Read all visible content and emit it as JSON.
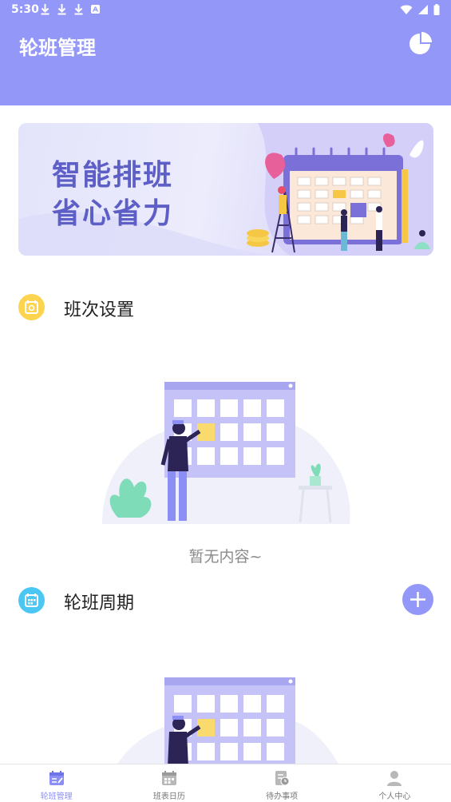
{
  "status": {
    "time": "5:30"
  },
  "header": {
    "title": "轮班管理"
  },
  "banner": {
    "line1": "智能排班",
    "line2": "省心省力"
  },
  "sections": [
    {
      "title": "班次设置",
      "empty_text": "暂无内容~"
    },
    {
      "title": "轮班周期"
    }
  ],
  "bottom_nav": [
    {
      "label": "轮班管理",
      "icon": "calendar-edit-icon",
      "active": true
    },
    {
      "label": "班表日历",
      "icon": "calendar-icon",
      "active": false
    },
    {
      "label": "待办事项",
      "icon": "todo-clock-icon",
      "active": false
    },
    {
      "label": "个人中心",
      "icon": "user-icon",
      "active": false
    }
  ],
  "colors": {
    "primary": "#9397f8",
    "active_nav": "#8b8ff5",
    "shift_icon": "#fdd44f",
    "cycle_icon": "#4cc6f2"
  }
}
